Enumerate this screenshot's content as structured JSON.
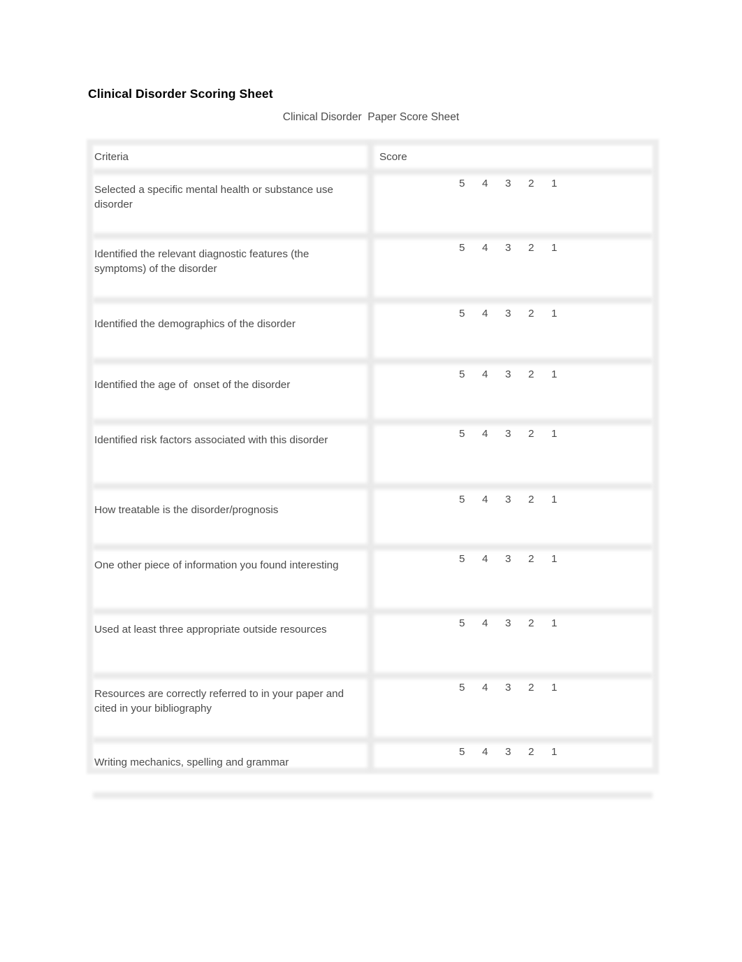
{
  "document": {
    "title": "Clinical Disorder Scoring Sheet",
    "subtitle": "Clinical Disorder  Paper Score Sheet"
  },
  "table": {
    "headers": {
      "criteria": "Criteria",
      "score": "Score"
    },
    "scale": [
      "5",
      "4",
      "3",
      "2",
      "1"
    ],
    "rows": [
      {
        "criteria": "Selected a specific mental health or substance use disorder",
        "lines": 2
      },
      {
        "criteria": "Identified the relevant diagnostic features (the symptoms) of the disorder",
        "lines": 2
      },
      {
        "criteria": "Identified the demographics of the disorder",
        "lines": 1
      },
      {
        "criteria": "Identified the age of  onset of the disorder",
        "lines": 1
      },
      {
        "criteria": "Identified risk factors associated with this disorder",
        "lines": 2
      },
      {
        "criteria": "How treatable is the disorder/prognosis",
        "lines": 1
      },
      {
        "criteria": "One other piece of information you found interesting",
        "lines": 2
      },
      {
        "criteria": "Used at least three appropriate outside resources",
        "lines": 2
      },
      {
        "criteria": "Resources are correctly referred to in your paper and cited in your bibliography",
        "lines": 2
      },
      {
        "criteria": "Writing mechanics, spelling and grammar",
        "lines": 1
      }
    ]
  },
  "colors": {
    "text": "#4a4a4a",
    "heading": "#000000",
    "border": "#e9e9e9",
    "background": "#ffffff"
  }
}
